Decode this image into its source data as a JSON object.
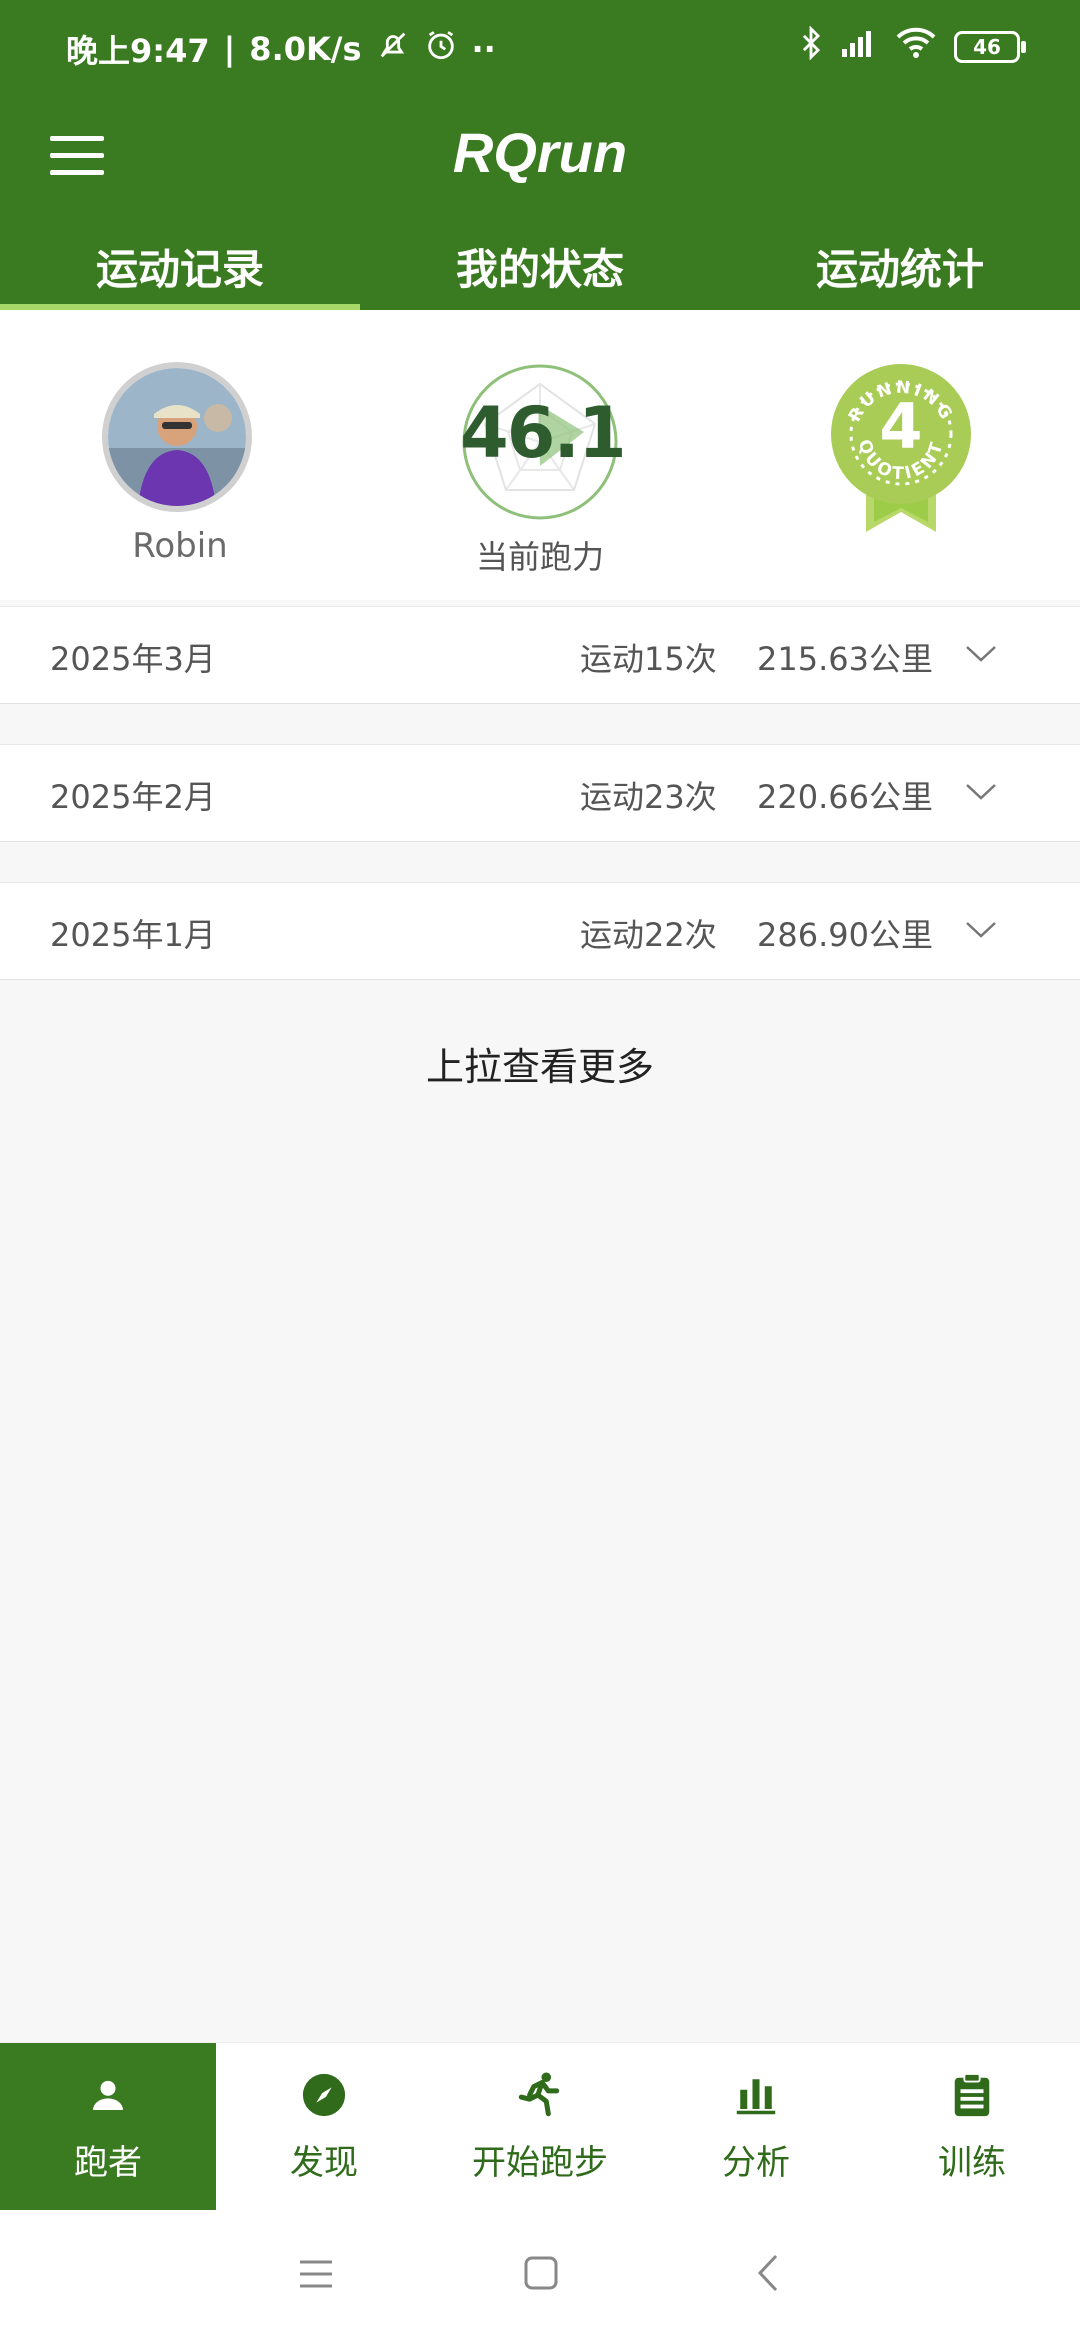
{
  "status_bar": {
    "time": "晚上9:47",
    "net_speed": "8.0K/s",
    "dots": "··",
    "battery": "46"
  },
  "app": {
    "title": "RQrun"
  },
  "tabs": [
    {
      "label": "运动记录",
      "active": true
    },
    {
      "label": "我的状态",
      "active": false
    },
    {
      "label": "运动统计",
      "active": false
    }
  ],
  "profile": {
    "name": "Robin",
    "running_power": "46.1",
    "running_power_label": "当前跑力",
    "badge": {
      "text": "RUNNING QUOTIENT",
      "level": "4"
    }
  },
  "records": [
    {
      "month": "2025年3月",
      "count": "运动15次",
      "distance": "215.63公里"
    },
    {
      "month": "2025年2月",
      "count": "运动23次",
      "distance": "220.66公里"
    },
    {
      "month": "2025年1月",
      "count": "运动22次",
      "distance": "286.90公里"
    }
  ],
  "load_more": "上拉查看更多",
  "bottom_nav": [
    {
      "label": "跑者",
      "icon": "person-icon",
      "active": true
    },
    {
      "label": "发现",
      "icon": "compass-icon",
      "active": false
    },
    {
      "label": "开始跑步",
      "icon": "runner-icon",
      "active": false
    },
    {
      "label": "分析",
      "icon": "bar-chart-icon",
      "active": false
    },
    {
      "label": "训练",
      "icon": "clipboard-icon",
      "active": false
    }
  ],
  "colors": {
    "primary": "#3a7a20",
    "tab_indicator": "#a6d86a",
    "badge": "#a8cc55",
    "power_text": "#2e5c2e"
  }
}
